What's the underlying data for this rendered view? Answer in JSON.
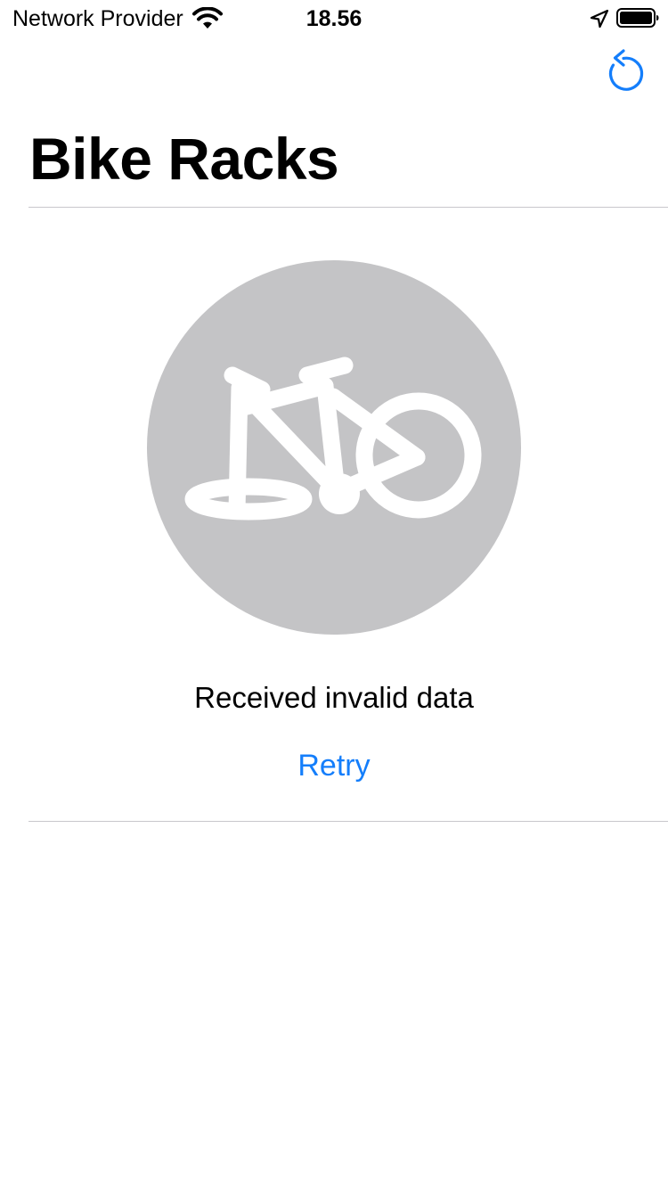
{
  "status_bar": {
    "carrier": "Network Provider",
    "time": "18.56"
  },
  "nav": {
    "refresh_icon": "refresh-icon",
    "title": "Bike Racks"
  },
  "empty_state": {
    "icon": "bicycle-icon",
    "message": "Received invalid data",
    "retry_label": "Retry"
  },
  "colors": {
    "accent": "#147efb",
    "illustration_bg": "#c4c4c6",
    "divider": "#c8c7cc"
  }
}
